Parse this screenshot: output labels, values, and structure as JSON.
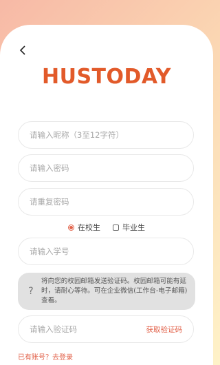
{
  "header": {
    "logo_text": "HUSTODAY"
  },
  "form": {
    "nickname_placeholder": "请输入昵称（3至12字符）",
    "password_placeholder": "请输入密码",
    "confirm_password_placeholder": "请重复密码",
    "student_id_placeholder": "请输入学号",
    "code_placeholder": "请输入验证码",
    "get_code_label": "获取验证码"
  },
  "identity": {
    "options": [
      {
        "label": "在校生",
        "selected": true
      },
      {
        "label": "毕业生",
        "selected": false
      }
    ]
  },
  "notice": {
    "icon": "question-icon",
    "text": "将向您的校园邮箱发送验证码。校园邮箱可能有延时，请耐心等待。可在企业微信(工作台-电子邮箱)查看。"
  },
  "footer": {
    "login_link": "已有账号？去登录"
  },
  "colors": {
    "accent": "#e2624a",
    "logo": "#e25a2a"
  }
}
